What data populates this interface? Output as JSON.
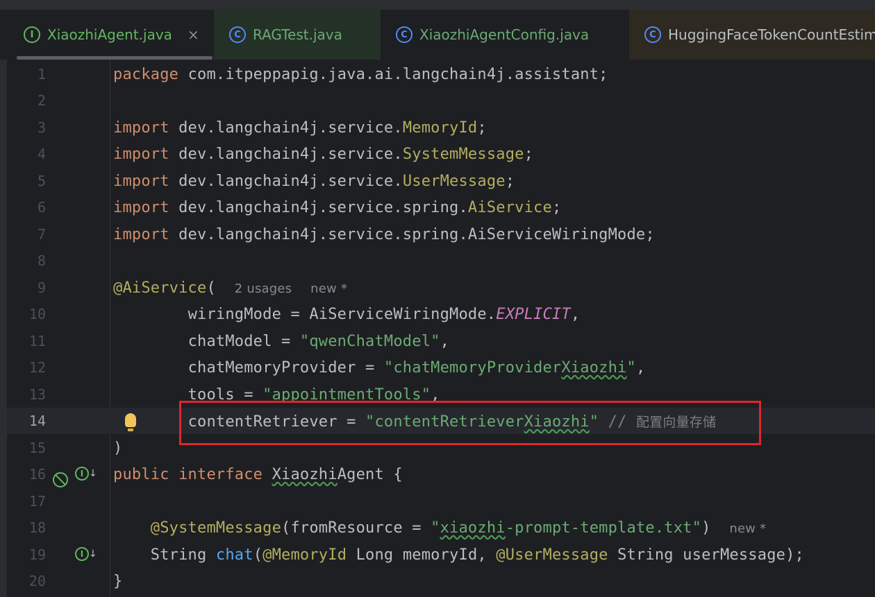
{
  "tabs": [
    {
      "label": "XiaozhiAgent.java",
      "icon": "interface-icon",
      "icon_glyph": "I",
      "active": true,
      "close": "×"
    },
    {
      "label": "RAGTest.java",
      "icon": "class-test-icon",
      "icon_glyph": "C"
    },
    {
      "label": "XiaozhiAgentConfig.java",
      "icon": "class-icon",
      "icon_glyph": "C"
    },
    {
      "label": "HuggingFaceTokenCountEstim",
      "icon": "class-icon",
      "icon_glyph": "C"
    }
  ],
  "colors": {
    "background": "#1e1f22",
    "keyword": "#cf8e6d",
    "annotation": "#b3ae60",
    "string": "#6aab73",
    "constant": "#c77dbb",
    "method": "#56a8f5",
    "comment": "#7a7e85",
    "highlight_border": "#e0262a"
  },
  "editor": {
    "current_line": 14,
    "line_numbers": [
      "1",
      "2",
      "3",
      "4",
      "5",
      "6",
      "7",
      "8",
      "9",
      "10",
      "11",
      "12",
      "13",
      "14",
      "15",
      "16",
      "17",
      "18",
      "19",
      "20"
    ],
    "l1": {
      "kw": "package",
      "rest": " com.itpeppapig.java.ai.langchain4j.assistant;"
    },
    "l3": {
      "kw": "import",
      "pkg": " dev.langchain4j.service.",
      "cls": "MemoryId",
      "end": ";"
    },
    "l4": {
      "kw": "import",
      "pkg": " dev.langchain4j.service.",
      "cls": "SystemMessage",
      "end": ";"
    },
    "l5": {
      "kw": "import",
      "pkg": " dev.langchain4j.service.",
      "cls": "UserMessage",
      "end": ";"
    },
    "l6": {
      "kw": "import",
      "pkg": " dev.langchain4j.service.spring.",
      "cls": "AiService",
      "end": ";"
    },
    "l7": {
      "kw": "import",
      "rest": " dev.langchain4j.service.spring.AiServiceWiringMode;"
    },
    "l9": {
      "ann": "@AiService",
      "paren": "(",
      "usages": "2 usages",
      "new": "new *"
    },
    "l10": {
      "indent": "        ",
      "name": "wiringMode = AiServiceWiringMode.",
      "const": "EXPLICIT",
      "end": ","
    },
    "l11": {
      "indent": "        ",
      "name": "chatModel = ",
      "str": "\"qwenChatModel\"",
      "end": ","
    },
    "l12": {
      "indent": "        ",
      "name": "chatMemoryProvider = ",
      "str_a": "\"chatMemoryProvider",
      "str_b": "Xiaozhi",
      "str_c": "\"",
      "end": ","
    },
    "l13": {
      "indent": "        ",
      "name": "tools = ",
      "str": "\"appointmentTools\"",
      "end": ","
    },
    "l14": {
      "indent": "        ",
      "name": "contentRetriever = ",
      "str_a": "\"contentRetriever",
      "str_b": "Xiaozhi",
      "str_c": "\"",
      "cmt": " // ",
      "cmt_text": "配置向量存储"
    },
    "l15": {
      "text": ")"
    },
    "l16": {
      "kw1": "public",
      "kw2": " interface ",
      "name": "Xiaozhi",
      "name2": "Agent",
      "rest": " {"
    },
    "l18": {
      "indent": "    ",
      "ann": "@SystemMessage",
      "a": "(fromResource = ",
      "str_a": "\"",
      "str_b": "xiaozhi",
      "str_c": "-prompt-template.txt\"",
      "end": ")",
      "new": "new *"
    },
    "l19": {
      "indent": "    ",
      "type": "String ",
      "fn": "chat",
      "a": "(",
      "ann1": "@MemoryId",
      "b": " Long memoryId, ",
      "ann2": "@UserMessage",
      "c": " String userMessage);"
    },
    "l20": {
      "text": "}"
    }
  },
  "gutter_icons": {
    "bulb": "lightbulb-icon",
    "line16": [
      "no-entry-icon",
      "implemented-interface-icon"
    ],
    "line19": [
      "implemented-method-icon"
    ],
    "impl_glyph": "I",
    "impl_arrow": "↓"
  }
}
